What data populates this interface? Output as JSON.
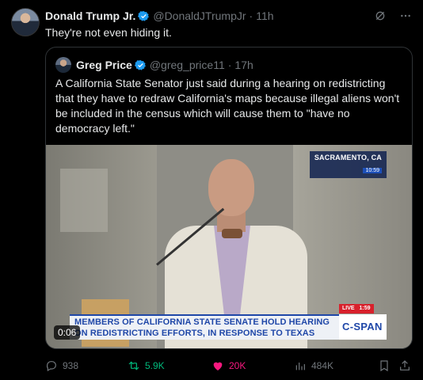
{
  "tweet": {
    "author_name": "Donald Trump Jr.",
    "handle": "@DonaldJTrumpJr",
    "separator": "·",
    "time": "11h",
    "text": "They're not even hiding it."
  },
  "quoted_tweet": {
    "author_name": "Greg Price",
    "handle": "@greg_price11",
    "separator": "·",
    "time": "17h",
    "text": "A California State Senator just said during a hearing on redistricting that they have to redraw California's maps because illegal aliens won't be included in the census which will cause them to \"have no democracy left.\"",
    "video": {
      "location": "SACRAMENTO, CA",
      "location_time": "10:59",
      "live_label": "LIVE",
      "live_time": "1:59",
      "banner_line1": "MEMBERS OF CALIFORNIA STATE SENATE HOLD HEARING",
      "banner_line2": "ON REDISTRICTING EFFORTS, IN RESPONSE TO TEXAS",
      "network_logo": "C-SPAN",
      "duration": "0:06"
    }
  },
  "actions": {
    "replies": "938",
    "retweets": "5.9K",
    "likes": "20K",
    "views": "484K"
  },
  "icons": {
    "verified": "verified-badge-icon",
    "grok": "grok-icon",
    "more": "more-icon",
    "reply": "reply-icon",
    "retweet": "retweet-icon",
    "like": "heart-icon",
    "views": "views-icon",
    "bookmark": "bookmark-icon",
    "share": "share-icon"
  },
  "colors": {
    "background": "#000000",
    "text": "#e7e9ea",
    "muted": "#71767b",
    "verified": "#1d9bf0",
    "retweet": "#00ba7c",
    "like": "#f91880",
    "cspan_blue": "#1f47a8"
  }
}
